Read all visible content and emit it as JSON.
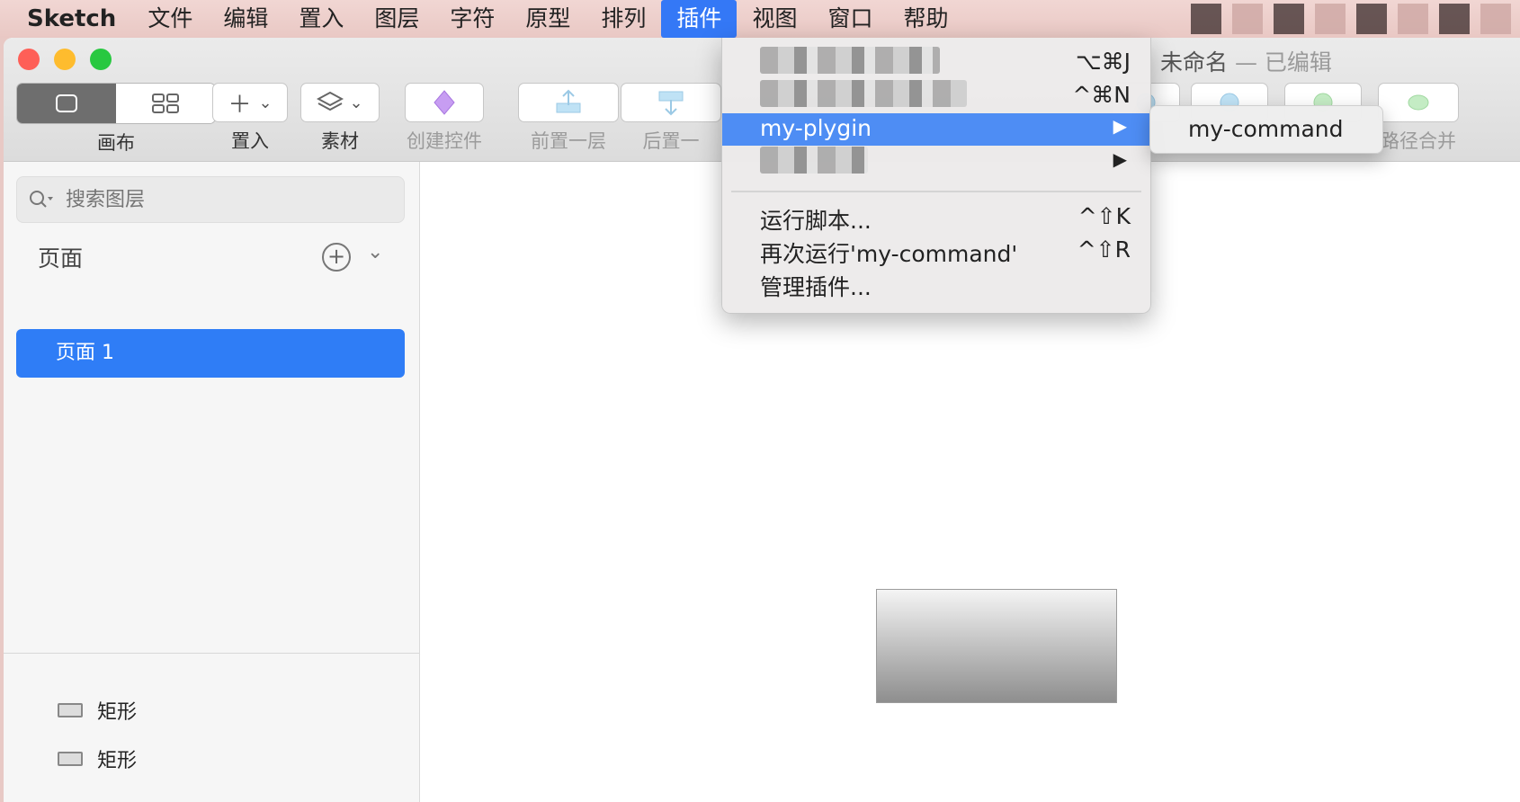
{
  "menubar": {
    "app": "Sketch",
    "items": [
      "文件",
      "编辑",
      "置入",
      "图层",
      "字符",
      "原型",
      "排列",
      "插件",
      "视图",
      "窗口",
      "帮助"
    ],
    "active_index": 7
  },
  "window": {
    "title": "未命名",
    "title_status": "— 已编辑"
  },
  "toolbar": {
    "canvas_label": "画布",
    "insert_label": "置入",
    "assets_label": "素材",
    "create_symbol_label": "创建控件",
    "bring_forward_label": "前置一层",
    "send_backward_label": "后置一",
    "path_combine_label": "路径合并"
  },
  "sidebar": {
    "search_placeholder": "搜索图层",
    "pages_header": "页面",
    "pages": [
      {
        "label": "页面 1",
        "selected": true
      }
    ],
    "layers": [
      {
        "label": "矩形"
      },
      {
        "label": "矩形"
      }
    ]
  },
  "plugin_menu": {
    "items": [
      {
        "label": "",
        "shortcut": "⌥⌘J",
        "redacted": true
      },
      {
        "label": "",
        "shortcut": "^⌘N",
        "redacted": true
      },
      {
        "label": "my-plygin",
        "submenu": true,
        "highlighted": true
      },
      {
        "label": "",
        "submenu": true,
        "redacted": true
      },
      {
        "label": "运行脚本...",
        "shortcut": "^⇧K"
      },
      {
        "label": "再次运行'my-command'",
        "shortcut": "^⇧R"
      },
      {
        "label": "管理插件..."
      }
    ],
    "submenu_items": [
      {
        "label": "my-command"
      }
    ]
  },
  "colors": {
    "accent": "#3478f6",
    "menu_highlight": "#4e8df4",
    "page_selected": "#2f7df6"
  }
}
